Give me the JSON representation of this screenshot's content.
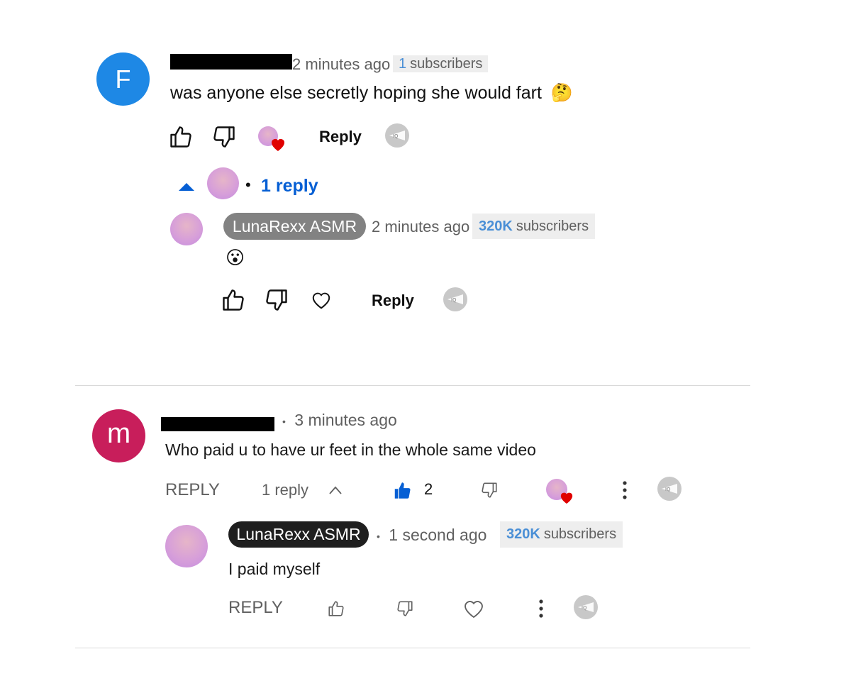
{
  "comments": [
    {
      "avatar_letter": "F",
      "avatar_color": "#1e88e5",
      "time": "2 minutes ago",
      "subs_count": "1",
      "subs_label": "subscribers",
      "text": "was anyone else secretly hoping she would fart",
      "emoji": "🤔",
      "reply_label": "Reply",
      "replies_toggle": "1 reply",
      "reply": {
        "author": "LunaRexx ASMR",
        "time": "2 minutes ago",
        "subs_count": "320K",
        "subs_label": "subscribers",
        "emoji": "😮",
        "reply_label": "Reply"
      }
    },
    {
      "avatar_letter": "m",
      "avatar_color": "#c81e5b",
      "time": "3 minutes ago",
      "text": "Who paid u to have ur feet in the whole same video",
      "reply_label": "REPLY",
      "replies_count": "1 reply",
      "likes": "2",
      "reply": {
        "author": "LunaRexx ASMR",
        "time": "1 second ago",
        "subs_count": "320K",
        "subs_label": "subscribers",
        "text": "I paid myself",
        "reply_label": "REPLY"
      }
    }
  ],
  "separator": "•",
  "iq_label": "IQ",
  "colors": {
    "link_blue": "#065fd4",
    "like_blue": "#065fd4",
    "heart_red": "#e00000",
    "muted": "#606060"
  }
}
